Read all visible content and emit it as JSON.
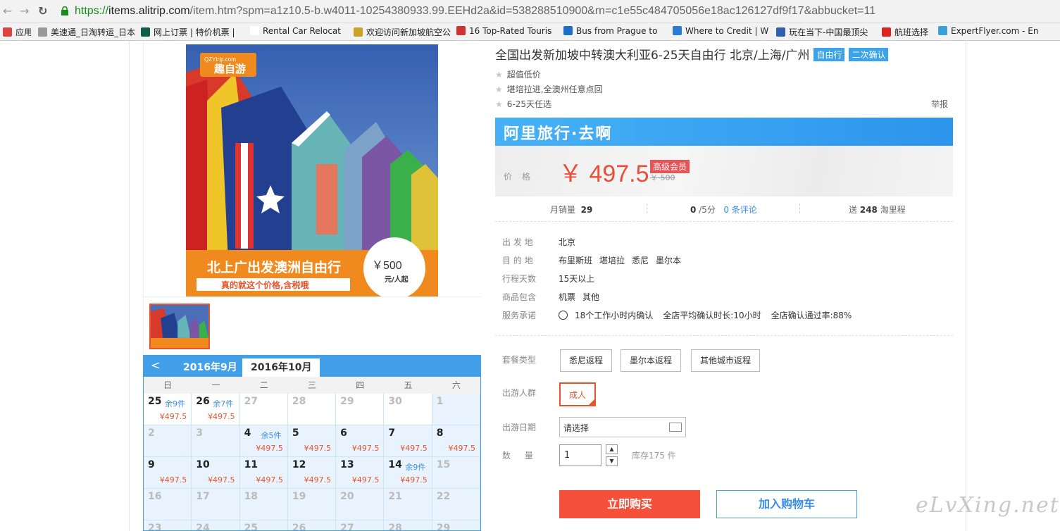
{
  "browser": {
    "url_scheme": "https://",
    "url_host": "items.alitrip.com",
    "url_path": "/item.htm?spm=a1z10.5-b.w4011-10254380933.99.EEHd2a&id=538288510900&rn=c1e55c484705056e18ac126127df9f17&abbucket=11",
    "bookmarks": [
      {
        "label": "应用",
        "color": "#d44"
      },
      {
        "label": "美速通_日淘转运_日本",
        "color": "#999"
      },
      {
        "label": "网上订票 | 特价机票 |",
        "color": "#0a5e4a"
      },
      {
        "label": "Rental Car Relocatio",
        "color": "#fff"
      },
      {
        "label": "欢迎访问新加坡航空公",
        "color": "#c9a227"
      },
      {
        "label": "16 Top-Rated Touris",
        "color": "#c33"
      },
      {
        "label": "Bus from Prague to",
        "color": "#1e6ec8"
      },
      {
        "label": "Where to Credit | W",
        "color": "#2a7bd8"
      },
      {
        "label": "玩在当下-中国最顶尖",
        "color": "#2e5fb0"
      },
      {
        "label": "航班选择",
        "color": "#d22"
      },
      {
        "label": "ExpertFlyer.com - En",
        "color": "#3aa0d8"
      }
    ]
  },
  "product": {
    "title": "全国出发新加坡中转澳大利亚6-25天自由行 北京/上海/广州",
    "tags": [
      "自由行",
      "二次确认"
    ],
    "features": [
      "超值低价",
      "堪培拉进,全澳州任意点回",
      "6-25天任选"
    ],
    "report": "举报",
    "image": {
      "brand_site": "QZYtrip.com",
      "brand_name": "趣自游",
      "headline": "北上广出发澳洲自由行",
      "subline": "真的就这个价格,含税哦",
      "badge_price": "￥500",
      "badge_unit": "元/人起"
    }
  },
  "banner": {
    "text": "阿里旅行·去啊"
  },
  "price": {
    "label": "价格",
    "value": "￥ 497.5",
    "vip_tag": "高级会员",
    "original": "￥ 500"
  },
  "stats": {
    "monthly_sales_label": "月销量",
    "monthly_sales": "29",
    "rating": "0",
    "rating_suffix": "/5分",
    "reviews": "0 条评论",
    "points_prefix": "送",
    "points": "248",
    "points_suffix": "淘里程"
  },
  "info": [
    {
      "label": "出 发 地",
      "values": [
        "北京"
      ]
    },
    {
      "label": "目 的 地",
      "values": [
        "布里斯班",
        "堪培拉",
        "悉尼",
        "墨尔本"
      ]
    },
    {
      "label": "行程天数",
      "values": [
        "15天以上"
      ]
    },
    {
      "label": "商品包含",
      "values": [
        "机票",
        "其他"
      ]
    },
    {
      "label": "服务承诺",
      "values": [
        "18个工作小时内确认",
        "全店平均确认时长:10小时",
        "全店确认通过率:88%"
      ]
    }
  ],
  "options": {
    "package_label": "套餐类型",
    "packages": [
      "悉尼返程",
      "墨尔本返程",
      "其他城市返程"
    ],
    "group_label": "出游人群",
    "group_selected": "成人",
    "date_label": "出游日期",
    "date_placeholder": "请选择",
    "qty_label": "数 量",
    "qty_value": "1",
    "stock_text": "库存175 件"
  },
  "actions": {
    "buy": "立即购买",
    "cart": "加入购物车"
  },
  "calendar": {
    "month_prev": "2016年9月",
    "month_current": "2016年10月",
    "weekdays": [
      "日",
      "一",
      "二",
      "三",
      "四",
      "五",
      "六"
    ],
    "cells": [
      {
        "day": "25",
        "stock": "余9件",
        "price": "¥497.5",
        "state": "avail"
      },
      {
        "day": "26",
        "stock": "余7件",
        "price": "¥497.5",
        "state": "avail"
      },
      {
        "day": "27",
        "stock": "",
        "price": "",
        "state": "dim"
      },
      {
        "day": "28",
        "stock": "",
        "price": "",
        "state": "dim"
      },
      {
        "day": "29",
        "stock": "",
        "price": "",
        "state": "dim"
      },
      {
        "day": "30",
        "stock": "",
        "price": "",
        "state": "dim"
      },
      {
        "day": "1",
        "stock": "",
        "price": "",
        "state": "dimblue"
      },
      {
        "day": "2",
        "stock": "",
        "price": "",
        "state": "dimblue"
      },
      {
        "day": "3",
        "stock": "",
        "price": "",
        "state": "dimblue"
      },
      {
        "day": "4",
        "stock": "余5件",
        "price": "¥497.5",
        "state": "in"
      },
      {
        "day": "5",
        "stock": "",
        "price": "¥497.5",
        "state": "in"
      },
      {
        "day": "6",
        "stock": "",
        "price": "¥497.5",
        "state": "in"
      },
      {
        "day": "7",
        "stock": "",
        "price": "¥497.5",
        "state": "in"
      },
      {
        "day": "8",
        "stock": "",
        "price": "¥497.5",
        "state": "in"
      },
      {
        "day": "9",
        "stock": "",
        "price": "¥497.5",
        "state": "in"
      },
      {
        "day": "10",
        "stock": "",
        "price": "¥497.5",
        "state": "in"
      },
      {
        "day": "11",
        "stock": "",
        "price": "¥497.5",
        "state": "in"
      },
      {
        "day": "12",
        "stock": "",
        "price": "¥497.5",
        "state": "in"
      },
      {
        "day": "13",
        "stock": "",
        "price": "¥497.5",
        "state": "in"
      },
      {
        "day": "14",
        "stock": "余9件",
        "price": "¥497.5",
        "state": "in"
      },
      {
        "day": "15",
        "stock": "",
        "price": "",
        "state": "dimblue"
      },
      {
        "day": "16",
        "stock": "",
        "price": "",
        "state": "dimblue"
      },
      {
        "day": "17",
        "stock": "",
        "price": "",
        "state": "dimblue"
      },
      {
        "day": "18",
        "stock": "",
        "price": "",
        "state": "dimblue"
      },
      {
        "day": "19",
        "stock": "",
        "price": "",
        "state": "dimblue"
      },
      {
        "day": "20",
        "stock": "",
        "price": "",
        "state": "dimblue"
      },
      {
        "day": "21",
        "stock": "",
        "price": "",
        "state": "dimblue"
      },
      {
        "day": "22",
        "stock": "",
        "price": "",
        "state": "dimblue"
      },
      {
        "day": "23",
        "stock": "",
        "price": "",
        "state": "dimblue"
      },
      {
        "day": "24",
        "stock": "",
        "price": "",
        "state": "dimblue"
      },
      {
        "day": "25",
        "stock": "",
        "price": "",
        "state": "dimblue"
      },
      {
        "day": "26",
        "stock": "",
        "price": "",
        "state": "dimblue"
      },
      {
        "day": "27",
        "stock": "",
        "price": "",
        "state": "dimblue"
      },
      {
        "day": "28",
        "stock": "",
        "price": "",
        "state": "dimblue"
      },
      {
        "day": "29",
        "stock": "",
        "price": "",
        "state": "dimblue"
      }
    ]
  },
  "watermark": "eLvXing.net",
  "colors": {
    "accent_blue": "#42a0e9",
    "price_red": "#e94f3a",
    "buy_red": "#f5503a"
  }
}
